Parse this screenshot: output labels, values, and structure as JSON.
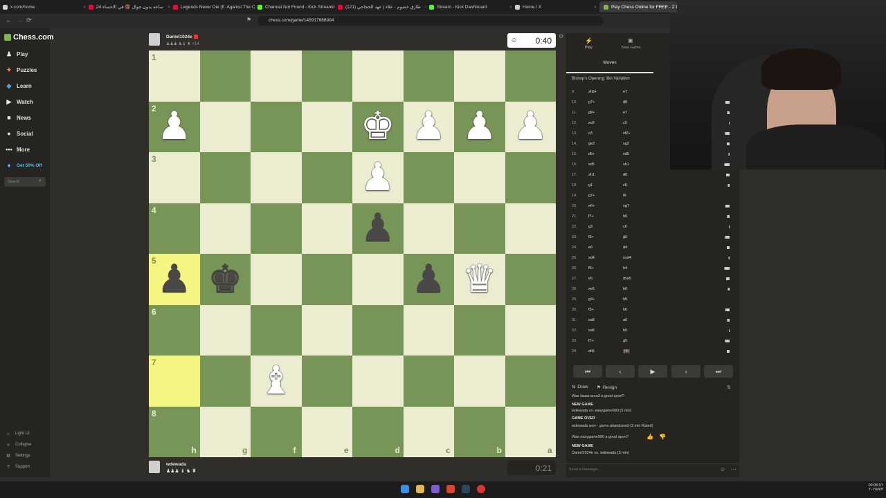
{
  "browser": {
    "tabs": [
      {
        "label": "x.com/home",
        "color": "#d0d0d0"
      },
      {
        "label": "24 ساعه بدون جوال 📵 في الاحساء",
        "color": "#ff0033"
      },
      {
        "label": "Legends Never Die (ft. Against The C",
        "color": "#ff0033"
      },
      {
        "label": "Channel Not Found - Kick Streaming",
        "color": "#53fc18"
      },
      {
        "label": "(121) طارق خشوم - علاء | عهد الحجاجي",
        "color": "#ff0033"
      },
      {
        "label": "Stream - Kick Dashboard",
        "color": "#53fc18"
      },
      {
        "label": "Home / X",
        "color": "#d0d0d0"
      },
      {
        "label": "Play Chess Online for FREE - 2 P",
        "color": "#81b64c"
      }
    ],
    "url": "chess.com/game/145917988904"
  },
  "sidebar": {
    "logo": "Chess.com",
    "items": [
      {
        "label": "Play",
        "icon": "pawn-icon",
        "glyph": "♟",
        "color": "#e8e8e8"
      },
      {
        "label": "Puzzles",
        "icon": "puzzle-icon",
        "glyph": "✦",
        "color": "#f7893b"
      },
      {
        "label": "Learn",
        "icon": "learn-icon",
        "glyph": "◆",
        "color": "#4fa3e0"
      },
      {
        "label": "Watch",
        "icon": "watch-icon",
        "glyph": "▶",
        "color": "#e8e8e8"
      },
      {
        "label": "News",
        "icon": "news-icon",
        "glyph": "■",
        "color": "#e8e8e8"
      },
      {
        "label": "Social",
        "icon": "social-icon",
        "glyph": "●",
        "color": "#e8e8e8"
      },
      {
        "label": "More",
        "icon": "more-icon",
        "glyph": "•••",
        "color": "#e8e8e8"
      }
    ],
    "promo": "Get 50% Off",
    "search_placeholder": "Search",
    "bottom": [
      {
        "label": "Light UI",
        "icon": "sun-icon",
        "glyph": "☼"
      },
      {
        "label": "Collapse",
        "icon": "collapse-icon",
        "glyph": "«"
      },
      {
        "label": "Settings",
        "icon": "gear-icon",
        "glyph": "⚙"
      },
      {
        "label": "Support",
        "icon": "help-icon",
        "glyph": "?"
      }
    ]
  },
  "top_player": {
    "name": "Daniel1024e",
    "material": "+14",
    "clock": "0:40"
  },
  "bottom_player": {
    "name": "wdewada",
    "clock": "0:21"
  },
  "board": {
    "rank_labels": [
      "1",
      "2",
      "3",
      "4",
      "5",
      "6",
      "7",
      "8"
    ],
    "file_labels": [
      "h",
      "g",
      "f",
      "e",
      "d",
      "c",
      "b",
      "a"
    ],
    "highlight_squares": [
      [
        4,
        0
      ],
      [
        6,
        0
      ]
    ],
    "pieces": [
      {
        "row": 1,
        "col": 0,
        "glyph": "♟",
        "side": "white",
        "name": "white-pawn-icon"
      },
      {
        "row": 1,
        "col": 4,
        "glyph": "♚",
        "side": "white",
        "name": "white-king-icon"
      },
      {
        "row": 1,
        "col": 5,
        "glyph": "♟",
        "side": "white",
        "name": "white-pawn-icon"
      },
      {
        "row": 1,
        "col": 6,
        "glyph": "♟",
        "side": "white",
        "name": "white-pawn-icon"
      },
      {
        "row": 1,
        "col": 7,
        "glyph": "♟",
        "side": "white",
        "name": "white-pawn-icon"
      },
      {
        "row": 2,
        "col": 4,
        "glyph": "♟",
        "side": "white",
        "name": "white-pawn-icon"
      },
      {
        "row": 3,
        "col": 4,
        "glyph": "♟",
        "side": "black",
        "name": "black-pawn-icon"
      },
      {
        "row": 4,
        "col": 0,
        "glyph": "♟",
        "side": "black",
        "name": "black-pawn-icon"
      },
      {
        "row": 4,
        "col": 1,
        "glyph": "♚",
        "side": "black",
        "name": "black-king-icon"
      },
      {
        "row": 4,
        "col": 5,
        "glyph": "♟",
        "side": "black",
        "name": "black-pawn-icon"
      },
      {
        "row": 4,
        "col": 6,
        "glyph": "♛",
        "side": "white",
        "name": "white-queen-icon"
      },
      {
        "row": 6,
        "col": 2,
        "glyph": "♝",
        "side": "white",
        "name": "white-bishop-icon"
      }
    ]
  },
  "panel": {
    "tab_play": "Play",
    "tab_new_game": "New Game",
    "moves_tab": "Moves",
    "opening": "Bishop's Opening: Boi Variation",
    "moves": [
      {
        "n": "9.",
        "w": "xh8+",
        "b": "e7"
      },
      {
        "n": "10.",
        "w": "g7+",
        "b": "d8"
      },
      {
        "n": "11.",
        "w": "g8+",
        "b": "e7"
      },
      {
        "n": "12.",
        "w": "xc8",
        "b": "c5"
      },
      {
        "n": "13.",
        "w": "c3",
        "b": "xf2+"
      },
      {
        "n": "14.",
        "w": "ge2",
        "b": "xg2"
      },
      {
        "n": "15.",
        "w": "d5+",
        "b": "xd5"
      },
      {
        "n": "16.",
        "w": "xd5",
        "b": "xh1"
      },
      {
        "n": "17.",
        "w": "xh1",
        "b": "d6"
      },
      {
        "n": "18.",
        "w": "g1",
        "b": "c5"
      },
      {
        "n": "19.",
        "w": "g7+",
        "b": "f6"
      },
      {
        "n": "20.",
        "w": "e6+",
        "b": "xg7"
      },
      {
        "n": "21.",
        "w": "f7+",
        "b": "h6"
      },
      {
        "n": "22.",
        "w": "g3",
        "b": "c6"
      },
      {
        "n": "23.",
        "w": "f5+",
        "b": "g5"
      },
      {
        "n": "24.",
        "w": "e6",
        "b": "d4"
      },
      {
        "n": "25.",
        "w": "xd4",
        "b": "exd4"
      },
      {
        "n": "26.",
        "w": "f5+",
        "b": "h4"
      },
      {
        "n": "27.",
        "w": "e5",
        "b": "dxe5"
      },
      {
        "n": "28.",
        "w": "xe5",
        "b": "b6"
      },
      {
        "n": "29.",
        "w": "g3+",
        "b": "h5"
      },
      {
        "n": "30.",
        "w": "f3+",
        "b": "h6"
      },
      {
        "n": "31.",
        "w": "xa8",
        "b": "a6"
      },
      {
        "n": "32.",
        "w": "xa6",
        "b": "b5"
      },
      {
        "n": "33.",
        "w": "f7+",
        "b": "g5"
      },
      {
        "n": "34.",
        "w": "xb5",
        "b": "h5"
      }
    ],
    "nav": [
      "⏮",
      "‹",
      "▶",
      "›",
      "⏭"
    ],
    "draw": "Draw",
    "resign": "Resign",
    "chat": [
      {
        "text": "Was kazar.arzu3 a good sport?",
        "bold": false
      },
      {
        "text": "NEW GAME",
        "bold": true
      },
      {
        "text": "wdewada vs. easygame990 (3 min)",
        "bold": false
      },
      {
        "text": "GAME OVER",
        "bold": true
      },
      {
        "text": "wdewada won - game abandoned (3 min Rated)",
        "bold": false
      },
      {
        "text": "Was easygame990 a good sport?",
        "bold": false
      },
      {
        "text": "NEW GAME",
        "bold": true
      },
      {
        "text": "Daniel1024e vs. wdewada (3 min)",
        "bold": false
      }
    ],
    "chat_placeholder": "Send a message..."
  },
  "taskbar": {
    "time": "03:06:57",
    "date": "٢٠٢٥/٧/٣"
  }
}
